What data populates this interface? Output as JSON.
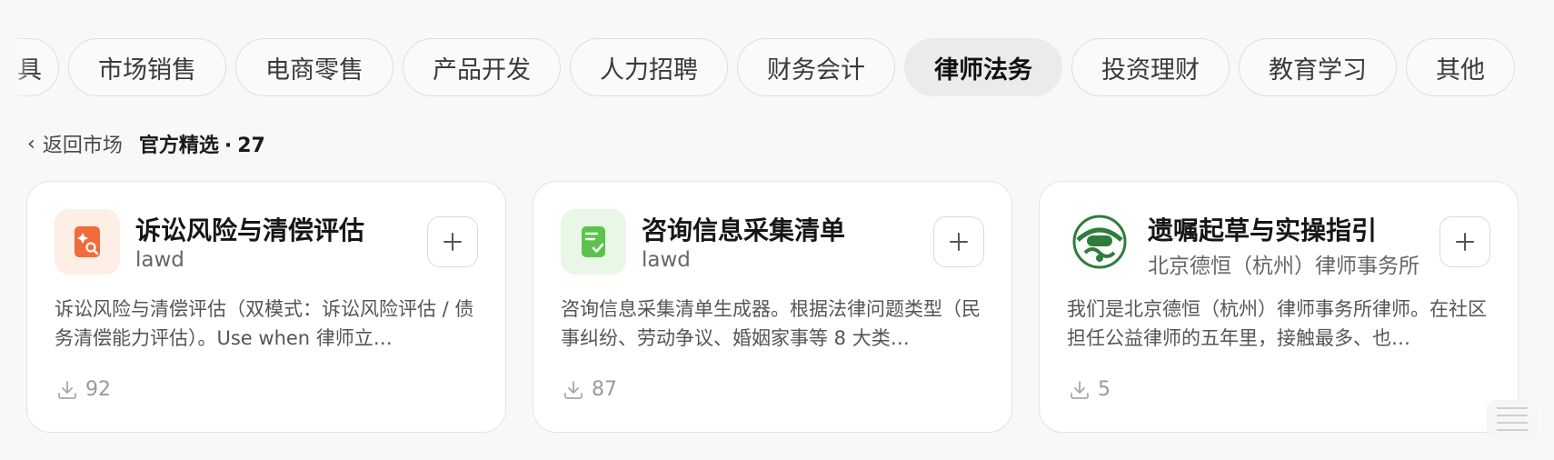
{
  "categories": {
    "partial_label": "具",
    "items": [
      {
        "label": "市场销售"
      },
      {
        "label": "电商零售"
      },
      {
        "label": "产品开发"
      },
      {
        "label": "人力招聘"
      },
      {
        "label": "财务会计"
      },
      {
        "label": "律师法务",
        "active": true
      },
      {
        "label": "投资理财"
      },
      {
        "label": "教育学习"
      },
      {
        "label": "其他"
      }
    ]
  },
  "breadcrumb": {
    "back_label": "返回市场",
    "section": "官方精选",
    "separator": "·",
    "count": "27"
  },
  "cards": [
    {
      "title": "诉讼风险与清偿评估",
      "author": "lawd",
      "description": "诉讼风险与清偿评估（双模式：诉讼风险评估 / 债务清偿能力评估）。Use when 律师立…",
      "downloads": "92",
      "icon": "risk-assessment-icon",
      "icon_bg": "#fdeee6",
      "icon_color": "#f26b3a"
    },
    {
      "title": "咨询信息采集清单",
      "author": "lawd",
      "description": "咨询信息采集清单生成器。根据法律问题类型（民事纠纷、劳动争议、婚姻家事等 8 大类…",
      "downloads": "87",
      "icon": "checklist-icon",
      "icon_bg": "#e9f7e7",
      "icon_color": "#5cc24d"
    },
    {
      "title": "遗嘱起草与实操指引",
      "author": "北京德恒（杭州）律师事务所",
      "description": "我们是北京德恒（杭州）律师事务所律师。在社区担任公益律师的五年里，接触最多、也…",
      "downloads": "5",
      "icon": "law-firm-logo-icon",
      "icon_bg": "#ffffff",
      "icon_color": "#2f7d3c"
    }
  ],
  "colors": {
    "background": "#f8f8f8",
    "card_border": "#e3e3e3",
    "active_chip": "#ebebeb"
  }
}
